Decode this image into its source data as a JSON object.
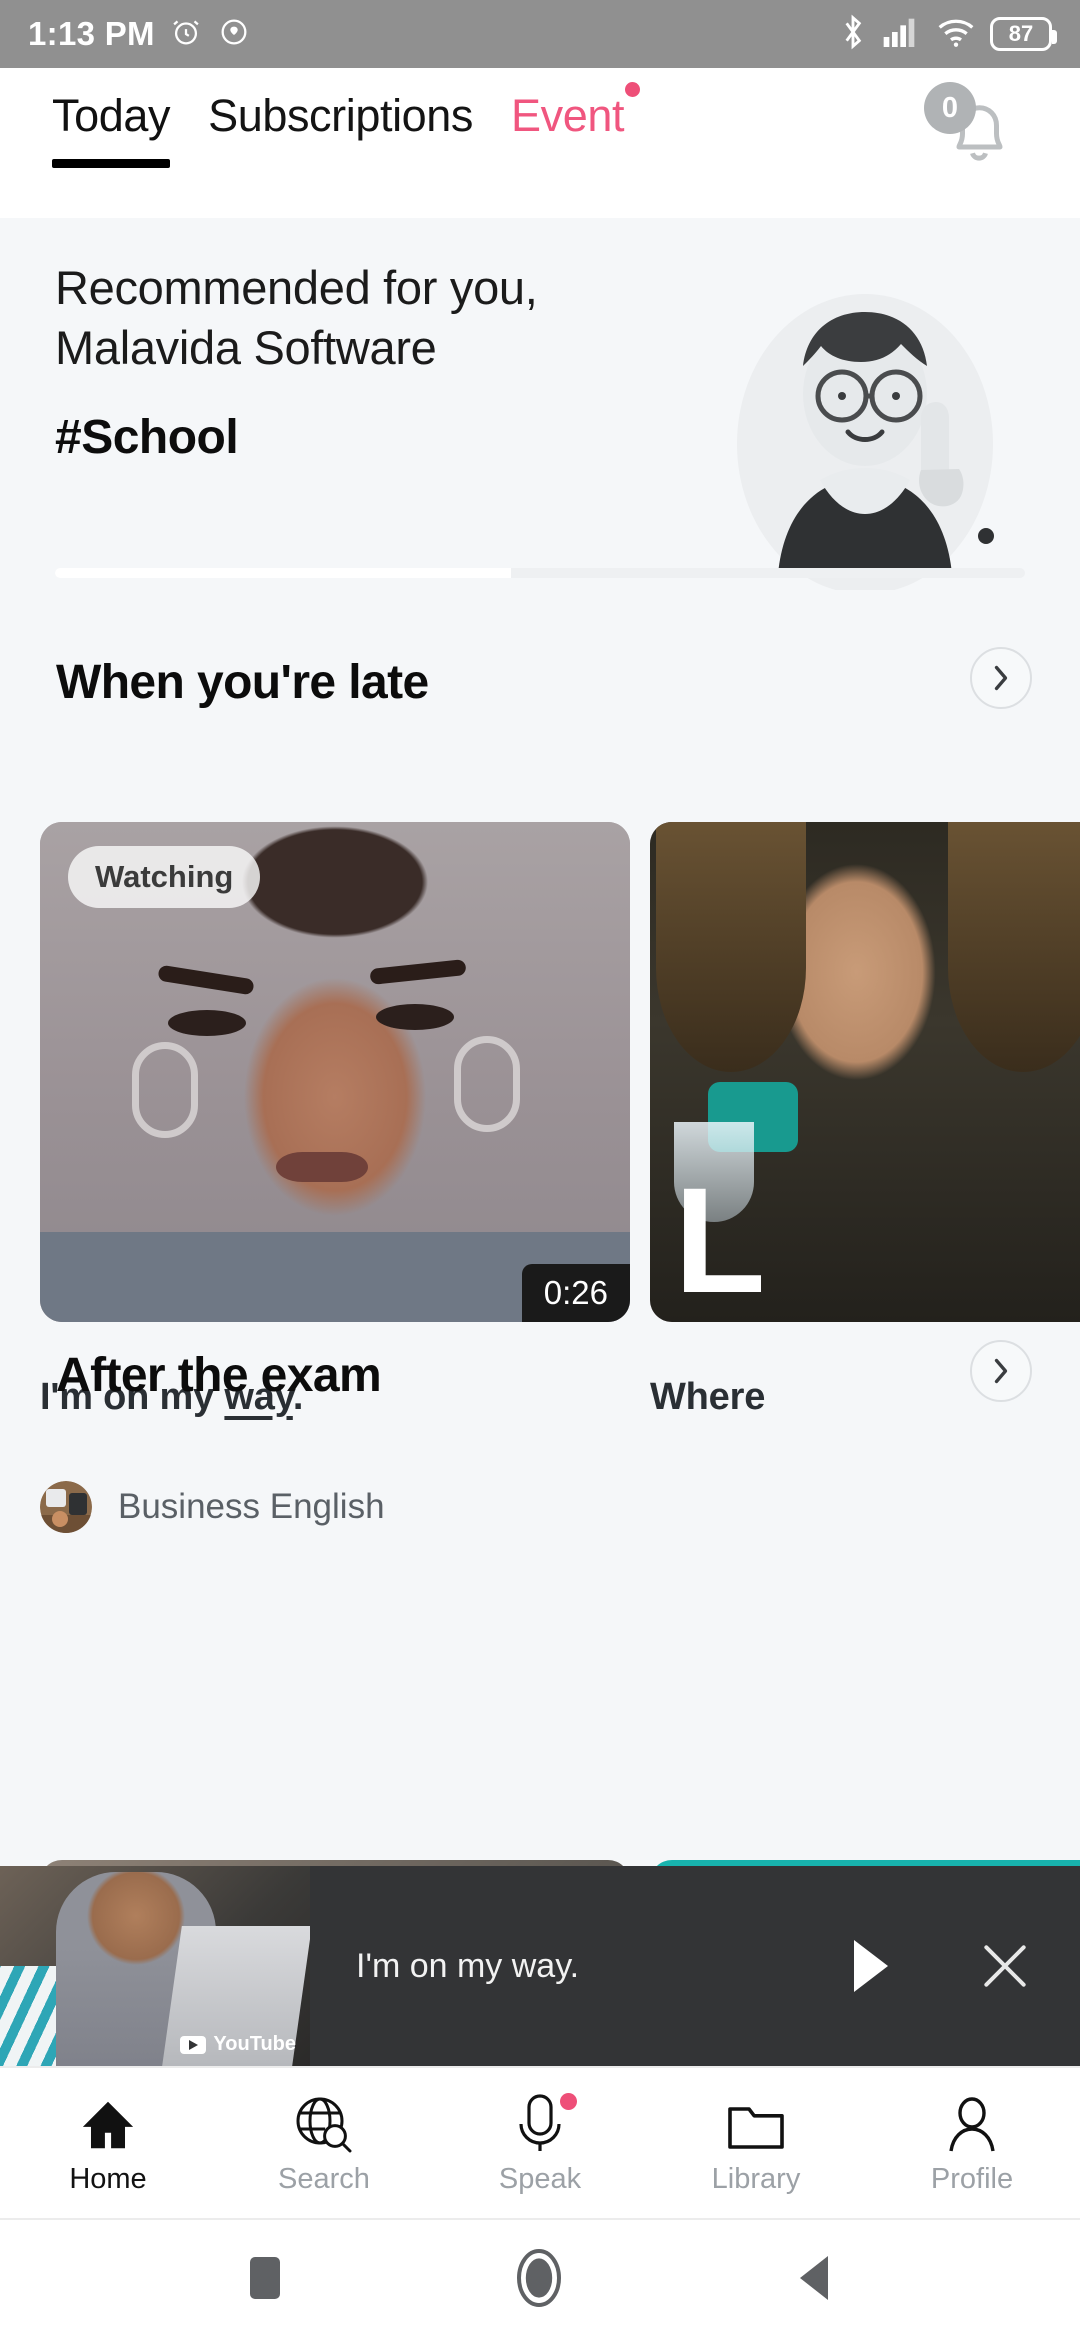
{
  "statusbar": {
    "time": "1:13 PM",
    "battery_percent": "87",
    "icons": [
      "alarm-icon",
      "shield-icon",
      "bluetooth-icon",
      "cellular-signal-icon",
      "wifi-icon",
      "battery-icon"
    ]
  },
  "tabbar": {
    "tabs": [
      {
        "label": "Today",
        "state": "active",
        "dot": false
      },
      {
        "label": "Subscriptions",
        "state": "inactive",
        "dot": false
      },
      {
        "label": "Event",
        "state": "accent",
        "dot": true
      }
    ],
    "notification_count": "0",
    "bell_icon": "bell-icon"
  },
  "hero": {
    "line1": "Recommended for you,",
    "line2": "Malavida Software",
    "tag": "#School",
    "progress_percent": 47
  },
  "sections": [
    {
      "title": "When you're late",
      "arrow_icon": "chevron-right-icon",
      "cards": [
        {
          "badge": "Watching",
          "duration": "0:26",
          "title_before": "I'm on my ",
          "title_underlined": "way",
          "title_after": ".",
          "channel": "Business English",
          "channel_avatar": "channel-avatar"
        },
        {
          "badge": "",
          "duration": "",
          "title_before": "Where",
          "title_underlined": "",
          "title_after": "",
          "channel": "",
          "channel_avatar": ""
        }
      ]
    },
    {
      "title": "After the exam",
      "arrow_icon": "chevron-right-icon",
      "cards": []
    }
  ],
  "miniplayer": {
    "title": "I'm on my way.",
    "watermark": "YouTube",
    "play_icon": "play-icon",
    "close_icon": "close-icon"
  },
  "bottomnav": {
    "items": [
      {
        "label": "Home",
        "icon": "home-icon",
        "active": true,
        "dot": false
      },
      {
        "label": "Search",
        "icon": "search-globe-icon",
        "active": false,
        "dot": false
      },
      {
        "label": "Speak",
        "icon": "microphone-icon",
        "active": false,
        "dot": true
      },
      {
        "label": "Library",
        "icon": "folder-icon",
        "active": false,
        "dot": false
      },
      {
        "label": "Profile",
        "icon": "person-icon",
        "active": false,
        "dot": false
      }
    ]
  },
  "androidnav": {
    "buttons": [
      "recents-button",
      "home-button",
      "back-button"
    ]
  },
  "colors": {
    "accent_pink": "#ee4f78",
    "page_bg": "#f5f7f9",
    "statusbar_bg": "#909090",
    "miniplayer_bg": "#333436"
  }
}
